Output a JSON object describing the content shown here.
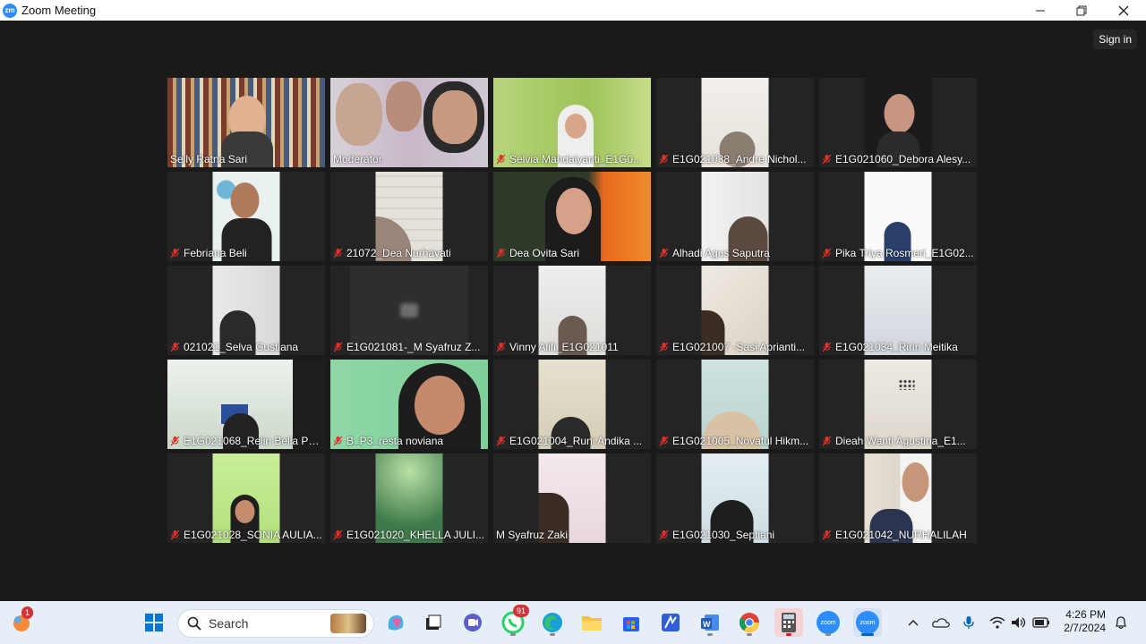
{
  "window": {
    "title": "Zoom Meeting",
    "logo_text": "zm"
  },
  "toolbar": {
    "sign_in_label": "Sign in"
  },
  "participants": [
    {
      "name": "Selly Ratna Sari",
      "muted": false
    },
    {
      "name": "Moderator",
      "muted": false,
      "active_speaker": true
    },
    {
      "name": "Selvia Mahdaiyanti_E1G0...",
      "muted": true
    },
    {
      "name": "E1G021038_Andre Nichol...",
      "muted": true
    },
    {
      "name": "E1G021060_Debora Alesy...",
      "muted": true
    },
    {
      "name": "Febriana Beli",
      "muted": true
    },
    {
      "name": "21072_Dea Nurhayati",
      "muted": true
    },
    {
      "name": "Dea Ovita Sari",
      "muted": true
    },
    {
      "name": "Alhadi Agus Saputra",
      "muted": true
    },
    {
      "name": "Pika Triya Rosmeri_E1G02...",
      "muted": true
    },
    {
      "name": "021021_Selva Gustiana",
      "muted": true
    },
    {
      "name": "E1G021081-_M Syafruz Z...",
      "muted": true
    },
    {
      "name": "Vinny Alifi_E1G021011",
      "muted": true
    },
    {
      "name": "E1G021007 -Sasi Aprianti...",
      "muted": true
    },
    {
      "name": "E1G021034_Ririn Meitika",
      "muted": true
    },
    {
      "name": "E1G021068_Relin Bella Pe...",
      "muted": true
    },
    {
      "name": "B_P3_resta noviana",
      "muted": true
    },
    {
      "name": "E1G021004_Runi Andika ...",
      "muted": true
    },
    {
      "name": "E1G021005_Novatul Hikm...",
      "muted": true
    },
    {
      "name": "Dieah Wanti Agustina_E1...",
      "muted": true
    },
    {
      "name": "E1G021028_SONIA AULIA...",
      "muted": true
    },
    {
      "name": "E1G021020_KHELLA JULI...",
      "muted": true
    },
    {
      "name": "M Syafruz Zaki",
      "muted": false
    },
    {
      "name": "E1G021030_Septiani",
      "muted": true
    },
    {
      "name": "E1G021042_NURHALILAH",
      "muted": true
    }
  ],
  "taskbar": {
    "search_label": "Search",
    "notification_badge": "1",
    "whatsapp_badge": "91",
    "time": "4:26 PM",
    "date": "2/7/2024",
    "zoom_label": "zoom"
  },
  "colors": {
    "active_speaker": "#f0f068",
    "muted_icon": "#e0312b",
    "zoom_blue": "#2d8cff"
  }
}
